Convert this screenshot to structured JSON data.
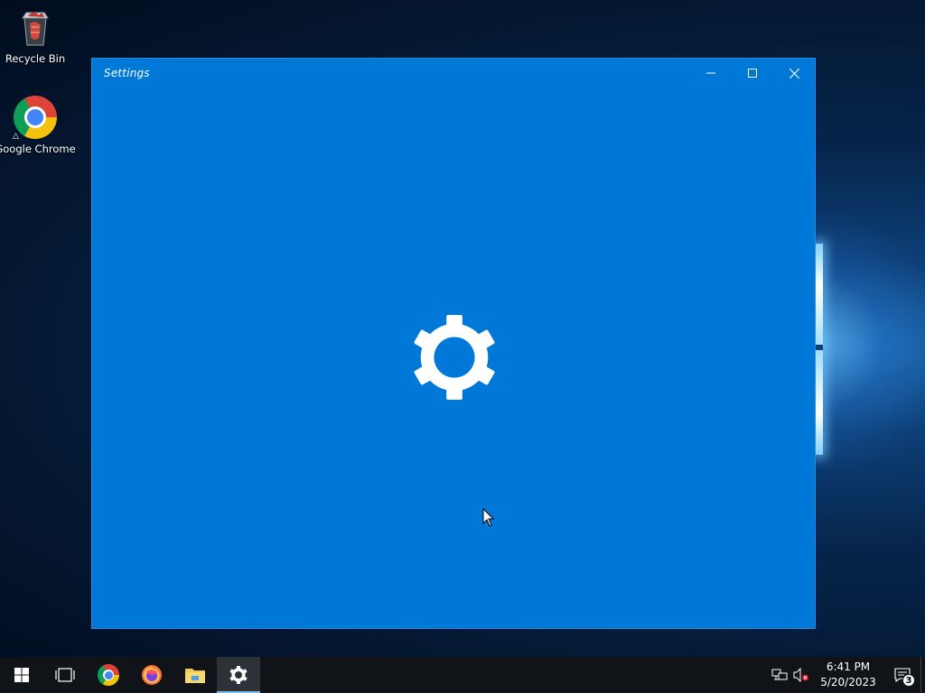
{
  "desktop": {
    "icons": [
      {
        "label": "Recycle Bin",
        "icon": "recycle-bin-icon"
      },
      {
        "label": "Google Chrome",
        "icon": "chrome-icon"
      }
    ]
  },
  "window": {
    "title": "Settings",
    "controls": [
      "minimize",
      "maximize",
      "close"
    ],
    "splash_icon": "gear-icon",
    "background": "#0078d7"
  },
  "taskbar": {
    "items": [
      {
        "name": "start",
        "icon": "windows-logo-icon"
      },
      {
        "name": "task-view",
        "icon": "task-view-icon"
      },
      {
        "name": "chrome",
        "icon": "chrome-icon"
      },
      {
        "name": "firefox",
        "icon": "firefox-icon"
      },
      {
        "name": "file-explorer",
        "icon": "folder-icon"
      },
      {
        "name": "settings",
        "icon": "gear-icon",
        "active": true
      }
    ],
    "tray": {
      "network_icon": "network-icon",
      "volume_icon": "volume-muted-icon",
      "time": "6:41 PM",
      "date": "5/20/2023",
      "notification_count": "3"
    }
  }
}
